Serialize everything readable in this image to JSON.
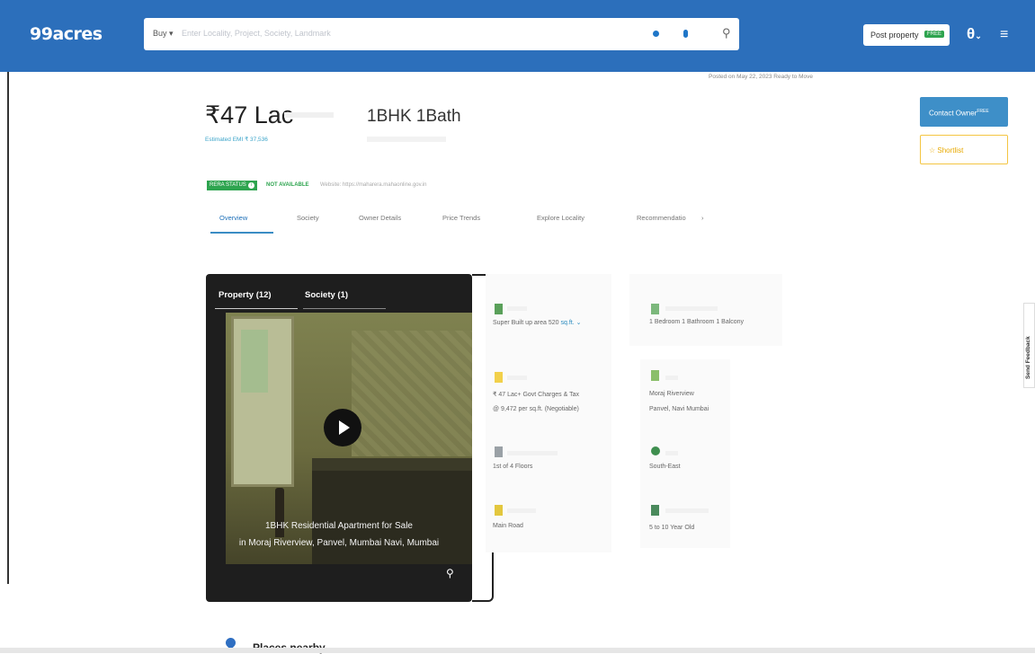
{
  "header": {
    "logo": "99acres",
    "search_type": "Buy",
    "search_placeholder": "Enter Locality, Project, Society, Landmark",
    "post_property": "Post property",
    "post_badge": "FREE"
  },
  "listing": {
    "posted": "Posted on May 22, 2023    Ready to Move",
    "price": "₹47 Lac",
    "emi": "Estimated EMI ₹ 37,536",
    "configuration": "1BHK 1Bath",
    "rera_status": "RERA STATUS",
    "rera_value": "NOT AVAILABLE",
    "rera_website": "Website: https://maharera.mahaonline.gov.in"
  },
  "tabs": [
    "Overview",
    "Society",
    "Owner Details",
    "Price Trends",
    "Explore Locality",
    "Recommendatio"
  ],
  "tabs_more": "›",
  "actions": {
    "contact": "Contact Owner",
    "contact_badge": "FREE",
    "shortlist": "☆ Shortlist"
  },
  "feedback": "Send Feedback",
  "media": {
    "tabs": [
      "Property (12)",
      "Society (1)"
    ],
    "caption_line1": "1BHK Residential Apartment for Sale",
    "caption_line2": "in Moraj Riverview, Panvel, Mumbai Navi, Mumbai"
  },
  "features": {
    "area": "Super Built up area 520",
    "area_unit": "sq.ft. ⌄",
    "rooms": "1 Bedroom  1 Bathroom  1 Balcony",
    "price": "₹ 47 Lac+ Govt Charges & Tax",
    "price_sqft": "@ 9,472 per sq.ft. (Negotiable)",
    "society": "Moraj Riverview",
    "society_loc": "Panvel, Navi Mumbai",
    "floor": "1st  of 4 Floors",
    "facing": "South-East",
    "overlooking": "Main Road",
    "age": "5 to 10 Year Old"
  },
  "places": "Places nearby",
  "colors": {
    "brand": "#2c6fbb",
    "accent": "#3e8fc8",
    "rera_green": "#2ea44f",
    "shortlist": "#f4c542"
  }
}
